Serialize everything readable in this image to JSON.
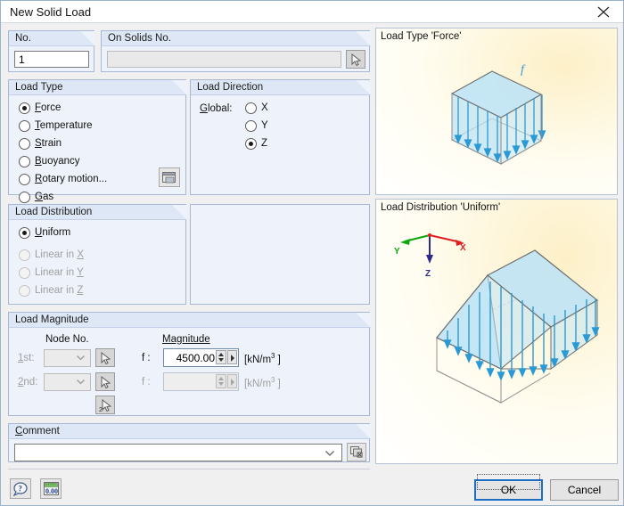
{
  "window": {
    "title": "New Solid Load",
    "close_icon": "close-icon"
  },
  "no_group": {
    "header": "No.",
    "value": "1"
  },
  "solids_group": {
    "header": "On Solids No.",
    "value": "",
    "pick_icon": "pick-cursor-icon"
  },
  "load_type": {
    "header": "Load Type",
    "options": [
      {
        "label": "Force",
        "selected": true,
        "enabled": true
      },
      {
        "label": "Temperature",
        "selected": false,
        "enabled": true
      },
      {
        "label": "Strain",
        "selected": false,
        "enabled": true
      },
      {
        "label": "Buoyancy",
        "selected": false,
        "enabled": true
      },
      {
        "label": "Rotary motion...",
        "selected": false,
        "enabled": true
      },
      {
        "label": "Gas",
        "selected": false,
        "enabled": true
      }
    ],
    "settings_icon": "dialog-window-icon"
  },
  "load_direction": {
    "header": "Load Direction",
    "global_label": "Global:",
    "options": [
      {
        "label": "X",
        "selected": false
      },
      {
        "label": "Y",
        "selected": false
      },
      {
        "label": "Z",
        "selected": true
      }
    ]
  },
  "load_distribution": {
    "header": "Load Distribution",
    "options": [
      {
        "label": "Uniform",
        "selected": true,
        "enabled": true
      },
      {
        "label": "Linear in X",
        "selected": false,
        "enabled": false
      },
      {
        "label": "Linear in Y",
        "selected": false,
        "enabled": false
      },
      {
        "label": "Linear in Z",
        "selected": false,
        "enabled": false
      }
    ]
  },
  "load_magnitude": {
    "header": "Load Magnitude",
    "node_col_label": "Node No.",
    "magnitude_col_label": "Magnitude",
    "rows": [
      {
        "row_label": "1st:",
        "node_value": "",
        "f_label": "f :",
        "value": "4500.00",
        "unit": "[kN/m3 ]",
        "enabled": true,
        "pick_icon": "pick-cursor-icon"
      },
      {
        "row_label": "2nd:",
        "node_value": "",
        "f_label": "f :",
        "value": "",
        "unit": "[kN/m3 ]",
        "enabled": false,
        "pick_icon": "pick-cursor-icon"
      }
    ],
    "multi_pick_icon": "pick-two-nodes-icon"
  },
  "comment": {
    "header": "Comment",
    "value": "",
    "dropdown_icon": "chevron-down-icon",
    "library_icon": "comment-library-icon"
  },
  "footer": {
    "help_icon": "help-question-icon",
    "units_icon": "units-0.00-icon",
    "ok_label": "OK",
    "cancel_label": "Cancel"
  },
  "preview_top": {
    "caption": "Load Type 'Force'",
    "force_label": "f"
  },
  "preview_bottom": {
    "caption": "Load Distribution 'Uniform'",
    "axis_x": "X",
    "axis_y": "Y",
    "axis_z": "Z"
  },
  "colors": {
    "accent_blue": "#1a6fc4",
    "solid_fill": "#bfe3f5",
    "arrow_blue": "#2a9ad6",
    "axis_x": "#e02020",
    "axis_y": "#0aa80a",
    "axis_z": "#2b2b8f",
    "panel_bg": "#eef2fa",
    "preview_bg": "#fffdf0"
  }
}
